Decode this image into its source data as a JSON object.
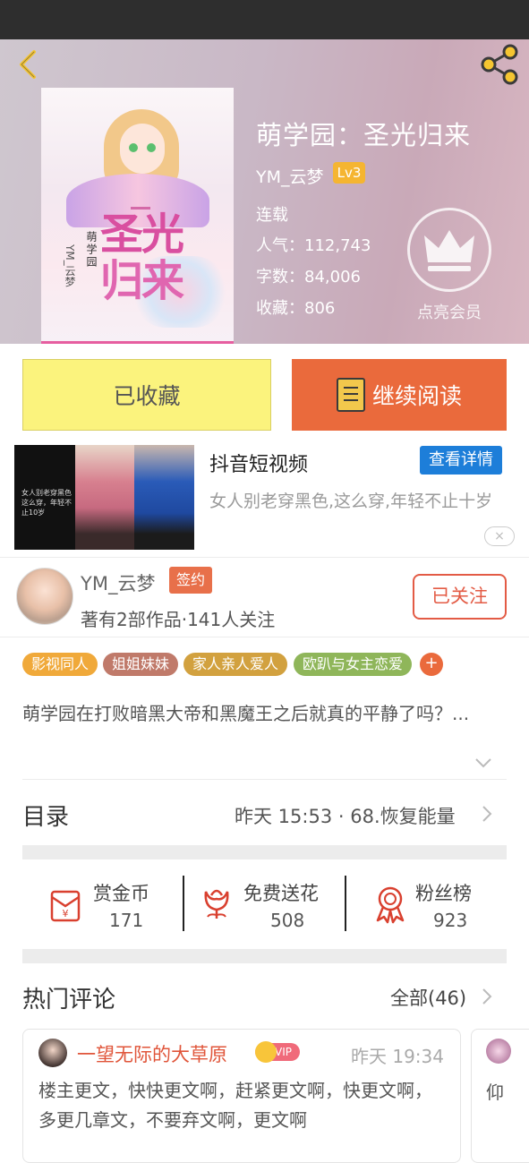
{
  "book": {
    "title": "萌学园：圣光归来",
    "author": "YM_云梦",
    "level": "Lv3",
    "status": "连载",
    "popularity": "人气：112,743",
    "words": "字数：84,006",
    "favorites": "收藏：806",
    "vip_label": "点亮会员",
    "cover_text": {
      "series": "萌学园",
      "title_line1": "圣光",
      "title_line2": "归来",
      "author": "YM_云梦"
    }
  },
  "actions": {
    "favorited": "已收藏",
    "continue_reading": "继续阅读"
  },
  "ad": {
    "title": "抖音短视频",
    "detail_button": "查看详情",
    "description": "女人别老穿黑色,这么穿,年轻不止十岁",
    "image_caption": "女人别老穿黑色 这么穿，年轻不止10岁",
    "close_icon": "×"
  },
  "author_card": {
    "name": "YM_云梦",
    "badge": "签约",
    "stats": "著有2部作品·141人关注",
    "follow_button": "已关注"
  },
  "tags": [
    {
      "label": "影视同人",
      "color": "#f0a93a"
    },
    {
      "label": "姐姐妹妹",
      "color": "#c07a6a"
    },
    {
      "label": "家人亲人爱人",
      "color": "#d2a13f"
    },
    {
      "label": "欧趴与女主恋爱",
      "color": "#8fb65a"
    }
  ],
  "tag_more": "+",
  "intro": "萌学园在打败暗黑大帝和黑魔王之后就真的平静了吗？...",
  "toc": {
    "label": "目录",
    "latest": "昨天 15:53 · 68.恢复能量"
  },
  "stats": [
    {
      "label": "赏金币",
      "value": "171",
      "icon": "red-envelope-icon"
    },
    {
      "label": "免费送花",
      "value": "508",
      "icon": "flower-icon"
    },
    {
      "label": "粉丝榜",
      "value": "923",
      "icon": "medal-icon"
    }
  ],
  "comments": {
    "heading": "热门评论",
    "all": "全部(46)",
    "items": [
      {
        "user": "一望无际的大草原",
        "badge": "VIP",
        "time": "昨天 19:34",
        "text": "楼主更文，快快更文啊，赶紧更文啊，快更文啊，多更几章文，不要弃文啊，更文啊"
      },
      {
        "text_preview": "仰"
      }
    ]
  },
  "colors": {
    "accent": "#ea6a3c",
    "favorite_bg": "#fbf37d",
    "ad_button": "#1d7ed9",
    "level_badge": "#f5b531"
  }
}
